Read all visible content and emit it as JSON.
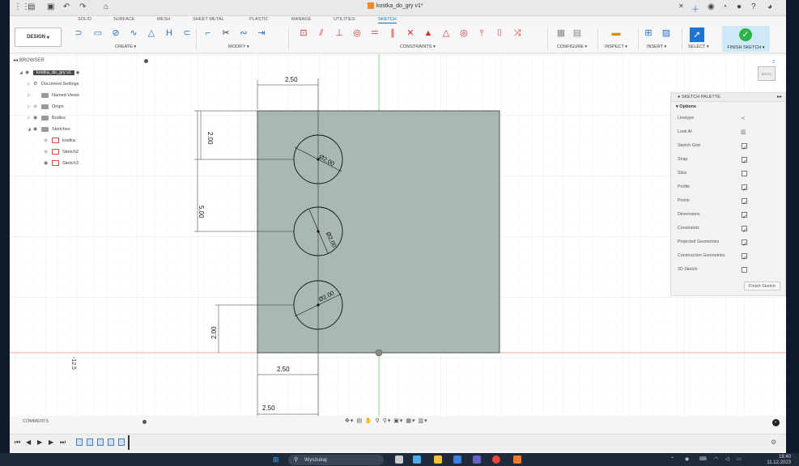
{
  "titlebar": {
    "doc_title": "kostka_do_gry v1*"
  },
  "ribbon": {
    "tabs": [
      "SOLID",
      "SURFACE",
      "MESH",
      "SHEET METAL",
      "PLASTIC",
      "MANAGE",
      "UTILITIES",
      "SKETCH"
    ],
    "active_tab": "SKETCH",
    "workspace": "DESIGN",
    "groups": [
      "CREATE",
      "MODIFY",
      "CONSTRAINTS",
      "CONFIGURE",
      "INSPECT",
      "INSERT",
      "SELECT"
    ],
    "finish_label": "FINISH SKETCH"
  },
  "browser": {
    "title": "BROWSER",
    "root": "kostka_do_gry v1",
    "items": [
      "Document Settings",
      "Named Views",
      "Origin",
      "Bodies",
      "Sketches"
    ],
    "sketches": [
      "kostka",
      "Sketch2",
      "Sketch3"
    ]
  },
  "palette": {
    "title": "SKETCH PALETTE",
    "section": "Options",
    "rows": [
      {
        "label": "Linetype",
        "type": "icon",
        "checked": null
      },
      {
        "label": "Look At",
        "type": "icon",
        "checked": null
      },
      {
        "label": "Sketch Grid",
        "type": "check",
        "checked": true
      },
      {
        "label": "Snap",
        "type": "check",
        "checked": true
      },
      {
        "label": "Slice",
        "type": "check",
        "checked": false
      },
      {
        "label": "Profile",
        "type": "check",
        "checked": true
      },
      {
        "label": "Points",
        "type": "check",
        "checked": true
      },
      {
        "label": "Dimensions",
        "type": "check",
        "checked": true
      },
      {
        "label": "Constraints",
        "type": "check",
        "checked": true
      },
      {
        "label": "Projected Geometries",
        "type": "check",
        "checked": true
      },
      {
        "label": "Construction Geometries",
        "type": "check",
        "checked": true
      },
      {
        "label": "3D Sketch",
        "type": "check",
        "checked": false
      }
    ],
    "finish_button": "Finish Sketch"
  },
  "viewcube": {
    "face": "BACK",
    "axis": "Z"
  },
  "sketch": {
    "dim_top": "2.50",
    "dim_left_short": "2.00",
    "dim_left_long": "5.00",
    "dim_bottom_left": "2.00",
    "dim_below1": "2.50",
    "dim_below2": "2.50",
    "circle1": "Ø2.00",
    "circle2": "Ø2.00",
    "circle3": "Ø2.00",
    "axis_readout": "-12.5"
  },
  "comments": {
    "title": "COMMENTS"
  },
  "taskbar": {
    "search_placeholder": "Wyszukaj",
    "time": "18:40",
    "date": "11.12.2023"
  },
  "colors": {
    "accent": "#0a6fc2",
    "profile_fill": "#a9b8b1",
    "finish_green": "#2db34a"
  }
}
